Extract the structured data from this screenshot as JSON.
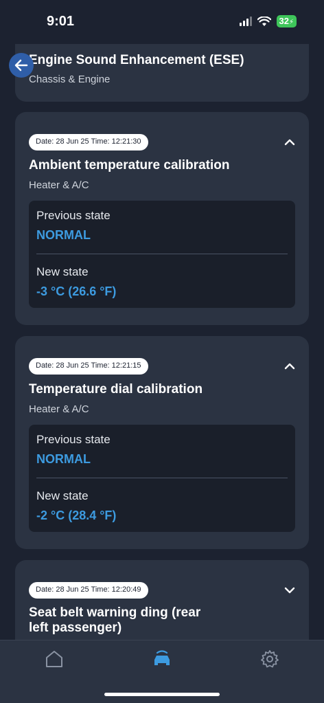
{
  "status_bar": {
    "time": "9:01",
    "battery": "32"
  },
  "prev_card": {
    "title": "Engine Sound Enhancement (ESE)",
    "category": "Chassis & Engine"
  },
  "cards": [
    {
      "date": "Date: 28 Jun 25 Time: 12:21:30",
      "title": "Ambient temperature calibration",
      "category": "Heater & A/C",
      "previous_label": "Previous state",
      "previous_value": "NORMAL",
      "new_label": "New state",
      "new_value": "-3 °C (26.6 °F)",
      "expanded": true
    },
    {
      "date": "Date: 28 Jun 25 Time: 12:21:15",
      "title": "Temperature dial calibration",
      "category": "Heater & A/C",
      "previous_label": "Previous state",
      "previous_value": "NORMAL",
      "new_label": "New state",
      "new_value": "-2 °C (28.4 °F)",
      "expanded": true
    },
    {
      "date": "Date: 28 Jun 25 Time: 12:20:49",
      "title_line1": "Seat belt warning ding (rear",
      "title_line2": "left passenger)",
      "expanded": false
    }
  ],
  "tabs": [
    {
      "name": "home",
      "icon": "home-icon",
      "active": false
    },
    {
      "name": "vehicle",
      "icon": "car-icon",
      "active": true
    },
    {
      "name": "settings",
      "icon": "gear-icon",
      "active": false
    }
  ],
  "colors": {
    "accent": "#3d9be0",
    "background": "#1c2230",
    "card": "#2b3342"
  }
}
